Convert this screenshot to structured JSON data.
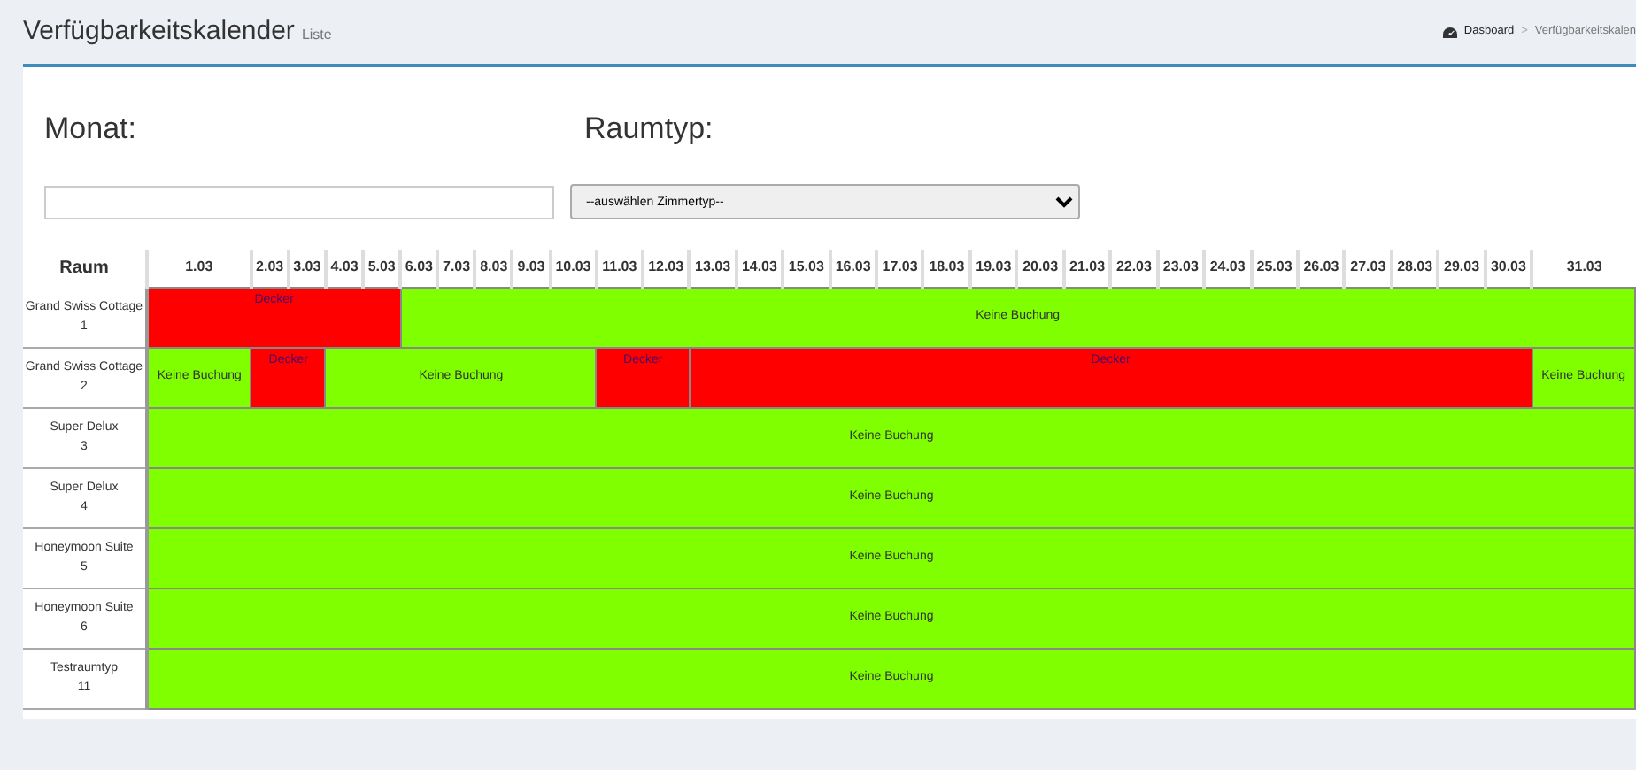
{
  "header": {
    "title": "Verfügbarkeitskalender",
    "subtitle": "Liste",
    "breadcrumb": [
      {
        "label": "Dasboard",
        "kind": "home"
      },
      {
        "label": "Verfügbarkeitskalen",
        "kind": "current"
      }
    ],
    "separator": ">"
  },
  "filters": [
    {
      "label": "Monat:",
      "kind": "input"
    },
    {
      "label": "Raumtyp:",
      "kind": "select",
      "value": "--auswählen Zimmertyp--"
    }
  ],
  "calendar": {
    "room_heading": "Raum",
    "days": [
      "1.03",
      "2.03",
      "3.03",
      "4.03",
      "5.03",
      "6.03",
      "7.03",
      "8.03",
      "9.03",
      "10.03",
      "11.03",
      "12.03",
      "13.03",
      "14.03",
      "15.03",
      "16.03",
      "17.03",
      "18.03",
      "19.03",
      "20.03",
      "21.03",
      "22.03",
      "23.03",
      "24.03",
      "25.03",
      "26.03",
      "27.03",
      "28.03",
      "29.03",
      "30.03",
      "31.03"
    ],
    "rows": [
      {
        "room": "Grand Swiss Cottage",
        "number": "1",
        "segments": [
          {
            "label": "Decker",
            "kind": "booked",
            "colspan": 5
          },
          {
            "label": "Keine Buchung",
            "kind": "free",
            "colspan": 26
          }
        ]
      },
      {
        "room": "Grand Swiss Cottage",
        "number": "2",
        "segments": [
          {
            "label": "Keine Buchung",
            "kind": "free"
          },
          {
            "label": "Decker",
            "kind": "booked",
            "colspan": 2
          },
          {
            "label": "Keine Buchung",
            "kind": "free",
            "colspan": 7
          },
          {
            "label": "Decker",
            "kind": "booked",
            "colspan": 2
          },
          {
            "label": "Decker",
            "kind": "booked",
            "colspan": 18
          },
          {
            "label": "Keine Buchung",
            "kind": "free"
          }
        ]
      },
      {
        "room": "Super Delux",
        "number": "3",
        "segments": [
          {
            "label": "Keine Buchung",
            "kind": "free",
            "colspan": 31
          }
        ]
      },
      {
        "room": "Super Delux",
        "number": "4",
        "segments": [
          {
            "label": "Keine Buchung",
            "kind": "free",
            "colspan": 31
          }
        ]
      },
      {
        "room": "Honeymoon Suite",
        "number": "5",
        "segments": [
          {
            "label": "Keine Buchung",
            "kind": "free",
            "colspan": 31
          }
        ]
      },
      {
        "room": "Honeymoon Suite",
        "number": "6",
        "segments": [
          {
            "label": "Keine Buchung",
            "kind": "free",
            "colspan": 31
          }
        ]
      },
      {
        "room": "Testraumtyp",
        "number": "11",
        "segments": [
          {
            "label": "Keine Buchung",
            "kind": "free",
            "colspan": 31
          }
        ]
      }
    ]
  }
}
